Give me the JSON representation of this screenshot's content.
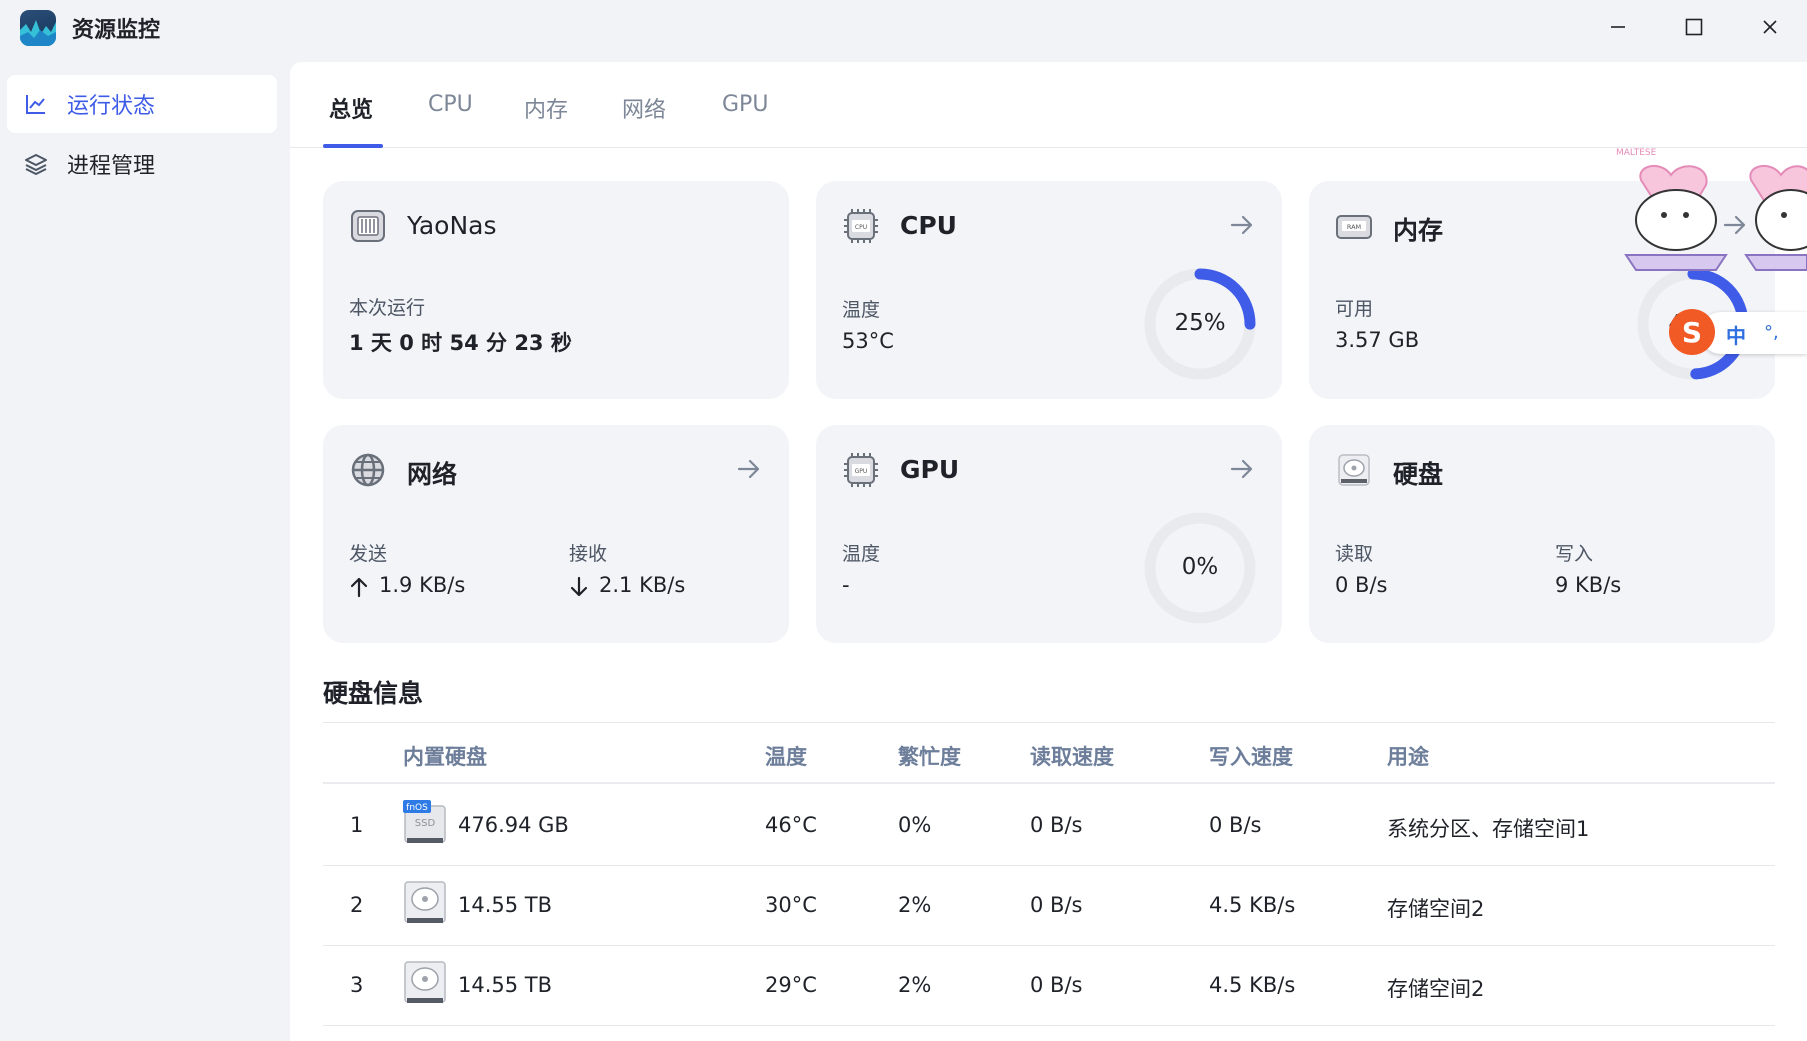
{
  "app": {
    "title": "资源监控"
  },
  "sidebar": {
    "items": [
      {
        "label": "运行状态",
        "active": true,
        "icon": "line-chart-icon"
      },
      {
        "label": "进程管理",
        "active": false,
        "icon": "layers-icon"
      }
    ]
  },
  "tabs": [
    {
      "label": "总览",
      "active": true
    },
    {
      "label": "CPU",
      "active": false
    },
    {
      "label": "内存",
      "active": false
    },
    {
      "label": "网络",
      "active": false
    },
    {
      "label": "GPU",
      "active": false
    }
  ],
  "cards": {
    "system": {
      "title": "YaoNas",
      "uptime_label": "本次运行",
      "uptime_value": "1 天 0 时 54 分 23 秒",
      "icon": "server-icon"
    },
    "cpu": {
      "title": "CPU",
      "temp_label": "温度",
      "temp_value": "53°C",
      "usage": 25,
      "usage_text": "25%",
      "icon": "cpu-chip-icon"
    },
    "memory": {
      "title": "内存",
      "avail_label": "可用",
      "avail_value": "3.57 GB",
      "usage": 49,
      "usage_text": "49",
      "icon": "ram-icon"
    },
    "network": {
      "title": "网络",
      "send_label": "发送",
      "send_value": "1.9 KB/s",
      "recv_label": "接收",
      "recv_value": "2.1 KB/s",
      "icon": "globe-icon"
    },
    "gpu": {
      "title": "GPU",
      "temp_label": "温度",
      "temp_value": "-",
      "usage": 0,
      "usage_text": "0%",
      "icon": "gpu-chip-icon"
    },
    "disk": {
      "title": "硬盘",
      "read_label": "读取",
      "read_value": "0 B/s",
      "write_label": "写入",
      "write_value": "9 KB/s",
      "icon": "hard-disk-icon"
    }
  },
  "disk_info": {
    "title": "硬盘信息",
    "columns": [
      "内置硬盘",
      "温度",
      "繁忙度",
      "读取速度",
      "写入速度",
      "用途"
    ],
    "rows": [
      {
        "index": "1",
        "type": "ssd",
        "badge": "fnOS",
        "badge_sub": "SSD",
        "size": "476.94 GB",
        "temp": "46°C",
        "busy": "0%",
        "read": "0 B/s",
        "write": "0 B/s",
        "usage": "系统分区、存储空间1"
      },
      {
        "index": "2",
        "type": "hdd",
        "size": "14.55 TB",
        "temp": "30°C",
        "busy": "2%",
        "read": "0 B/s",
        "write": "4.5 KB/s",
        "usage": "存储空间2"
      },
      {
        "index": "3",
        "type": "hdd",
        "size": "14.55 TB",
        "temp": "29°C",
        "busy": "2%",
        "read": "0 B/s",
        "write": "4.5 KB/s",
        "usage": "存储空间2"
      }
    ]
  },
  "overlay": {
    "sticker_text": "MALTESE",
    "ime_label": "中"
  },
  "colors": {
    "accent": "#3f5ce8",
    "ring_track": "#e8eaee",
    "card_bg": "#f2f4f8"
  }
}
